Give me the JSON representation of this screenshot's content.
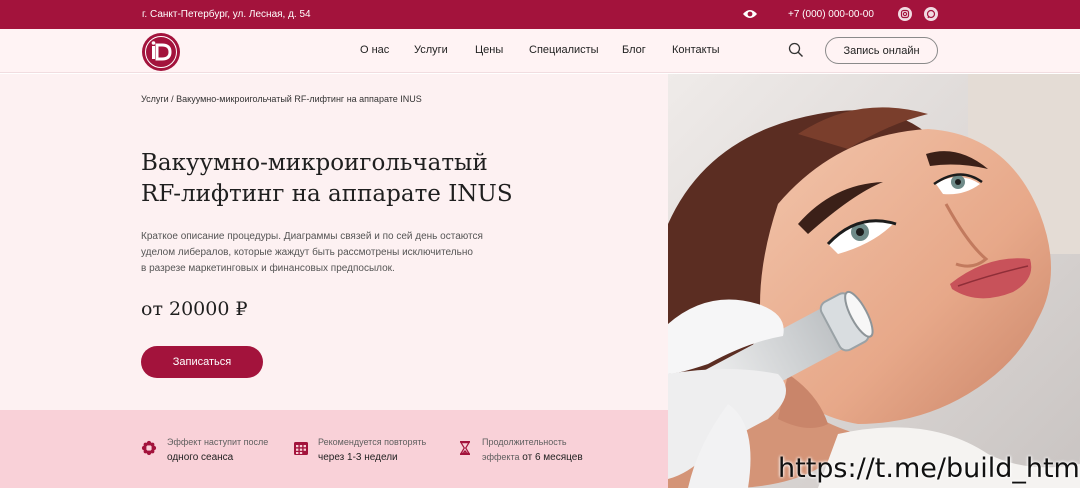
{
  "topbar": {
    "address": "г. Санкт-Петербург, ул. Лесная, д. 54",
    "phone": "+7 (000) 000-00-00",
    "bg_color": "#a3133c"
  },
  "header": {
    "nav": [
      "О нас",
      "Услуги",
      "Цены",
      "Специалисты",
      "Блог",
      "Контакты"
    ],
    "book_label": "Запись онлайн"
  },
  "hero": {
    "breadcrumb": "Услуги / Вакуумно-микроигольчатый RF-лифтинг на аппарате INUS",
    "title_line1": "Вакуумно-микроигольчатый",
    "title_line2": "RF-лифтинг на аппарате INUS",
    "desc_line1": "Краткое описание процедуры. Диаграммы связей и по сей день остаются",
    "desc_line2": "уделом либералов, которые жаждут быть рассмотрены исключительно",
    "desc_line3": "в разрезе маркетинговых и финансовых предпосылок.",
    "price": "от 20000 ₽",
    "cta_label": "Записаться"
  },
  "features": [
    {
      "icon": "flower-icon",
      "small": "Эффект наступит после",
      "big": "одного сеанса"
    },
    {
      "icon": "calendar-icon",
      "small": "Рекомендуется повторять",
      "big": "через 1-3 недели"
    },
    {
      "icon": "hourglass-icon",
      "small": "Продолжительность",
      "big_prefix": "эффекта",
      "big": "от 6 месяцев"
    }
  ],
  "watermark": "https://t.me/build_html",
  "colors": {
    "accent": "#a3133c",
    "hero_bg": "#fdf1f2",
    "features_bg": "#f9d1d8"
  }
}
